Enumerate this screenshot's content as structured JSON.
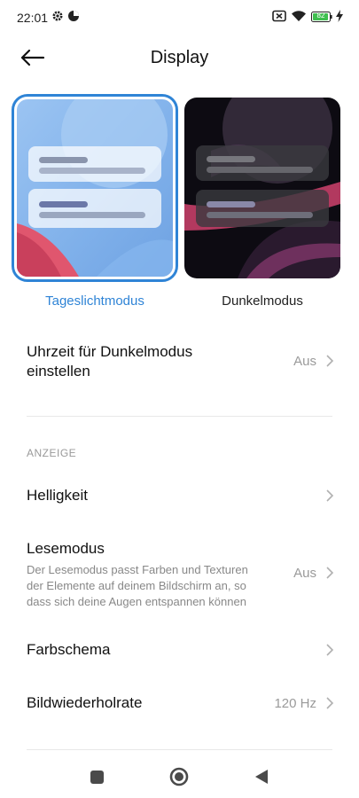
{
  "status_bar": {
    "time": "22:01",
    "battery": "82",
    "icons": [
      "settings-gear-icon",
      "data-saver-icon",
      "no-sim-icon",
      "wifi-icon",
      "battery-icon",
      "charging-icon"
    ]
  },
  "header": {
    "title": "Display",
    "back_icon": "arrow-left-icon"
  },
  "themes": {
    "light_label": "Tageslichtmodus",
    "dark_label": "Dunkelmodus",
    "selected": "light",
    "accent_color": "#2f84d6"
  },
  "dark_schedule": {
    "title_line1": "Uhrzeit für Dunkelmodus",
    "title_line2": "einstellen",
    "value": "Aus"
  },
  "section": {
    "label": "ANZEIGE"
  },
  "items": {
    "brightness": {
      "title": "Helligkeit"
    },
    "reading": {
      "title": "Lesemodus",
      "desc_line1": "Der Lesemodus passt Farben und Texturen",
      "desc_line2": "der Elemente auf deinem Bildschirm an, so",
      "desc_line3": "dass sich deine Augen entspannen können",
      "value": "Aus"
    },
    "color_scheme": {
      "title": "Farbschema"
    },
    "refresh_rate": {
      "title": "Bildwiederholrate",
      "value": "120 Hz"
    }
  },
  "navbar": {
    "icons": [
      "recents-square-icon",
      "home-circle-icon",
      "back-triangle-icon"
    ]
  }
}
